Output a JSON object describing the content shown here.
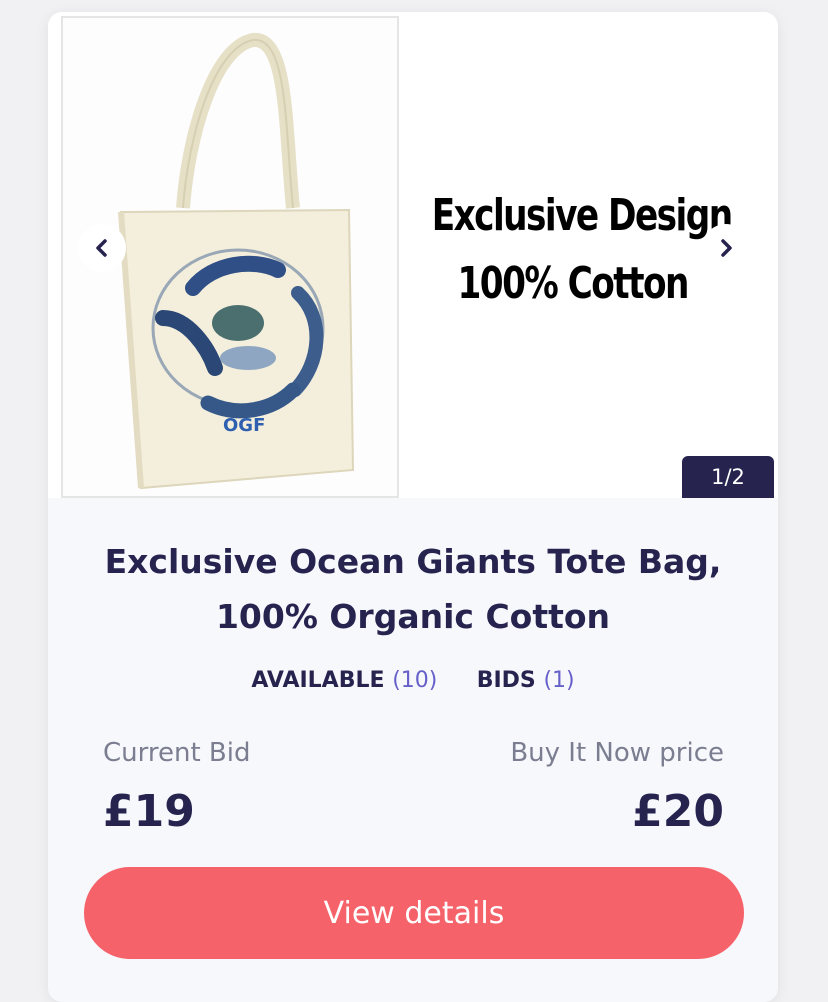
{
  "gallery": {
    "slide_text_line1": "Exclusive Design",
    "slide_text_line2": "100% Cotton",
    "bag_logo_text": "OGF",
    "counter": "1/2",
    "arrow_color": "#26244f"
  },
  "product": {
    "title": "Exclusive Ocean Giants Tote Bag, 100% Organic Cotton",
    "available_label": "AVAILABLE",
    "available_count": "(10)",
    "bids_label": "BIDS",
    "bids_count": "(1)"
  },
  "pricing": {
    "current_bid_label": "Current Bid",
    "current_bid_value": "£19",
    "buy_now_label": "Buy It Now price",
    "buy_now_value": "£20"
  },
  "actions": {
    "view_details_label": "View details"
  },
  "colors": {
    "navy": "#26244f",
    "accent_purple": "#6660c9",
    "cta": "#f56269"
  }
}
